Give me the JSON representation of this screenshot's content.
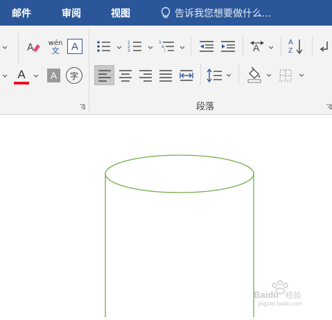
{
  "tabs": [
    {
      "label": "邮件"
    },
    {
      "label": "审阅"
    },
    {
      "label": "视图"
    }
  ],
  "tell_me": {
    "text": "告诉我您想要做什么...",
    "icon": "lightbulb-icon"
  },
  "font_group": {
    "phonetic_guide": {
      "top": "wén",
      "bottom": "文"
    },
    "enclose_char": "字",
    "char_border": "A",
    "font_color": "A",
    "char_shading": "A"
  },
  "paragraph_group": {
    "label": "段落"
  },
  "colors": {
    "tab_bar": "#2b579a",
    "ribbon": "#f3f3f3",
    "shape_outline": "#70ad47",
    "font_color_bar": "#e81123"
  },
  "watermark": {
    "text": "Baidu 经验",
    "url": "jingyan.baidu.com"
  }
}
